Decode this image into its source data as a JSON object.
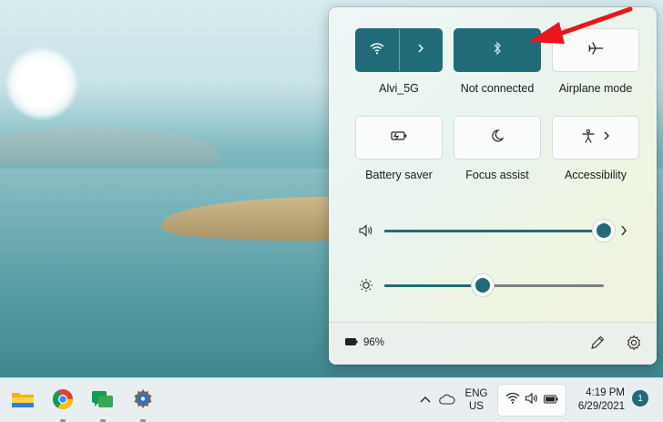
{
  "quick_settings": {
    "tiles": [
      {
        "label": "Alvi_5G",
        "icon": "wifi-icon",
        "active": true,
        "has_arrow": true
      },
      {
        "label": "Not connected",
        "icon": "bluetooth-icon",
        "active": true,
        "has_arrow": false
      },
      {
        "label": "Airplane mode",
        "icon": "airplane-icon",
        "active": false,
        "has_arrow": false
      },
      {
        "label": "Battery saver",
        "icon": "battery-saver-icon",
        "active": false,
        "has_arrow": false
      },
      {
        "label": "Focus assist",
        "icon": "moon-icon",
        "active": false,
        "has_arrow": false
      },
      {
        "label": "Accessibility",
        "icon": "accessibility-icon",
        "active": false,
        "has_arrow": true
      }
    ],
    "volume": {
      "icon": "speaker-icon",
      "level": 1.0
    },
    "brightness": {
      "icon": "sun-icon",
      "level": 0.45
    },
    "footer": {
      "battery_percent": "96%",
      "edit_icon": "pencil-icon",
      "settings_icon": "gear-icon"
    }
  },
  "taskbar": {
    "apps": [
      "file-explorer-icon",
      "chrome-icon",
      "chat-icon",
      "settings-app-icon"
    ],
    "language": {
      "line1": "ENG",
      "line2": "US"
    },
    "clock": {
      "time": "4:19 PM",
      "date": "6/29/2021"
    },
    "notification_count": "1"
  },
  "colors": {
    "accent": "#1f6c78",
    "annotation_arrow": "#e8161b"
  }
}
